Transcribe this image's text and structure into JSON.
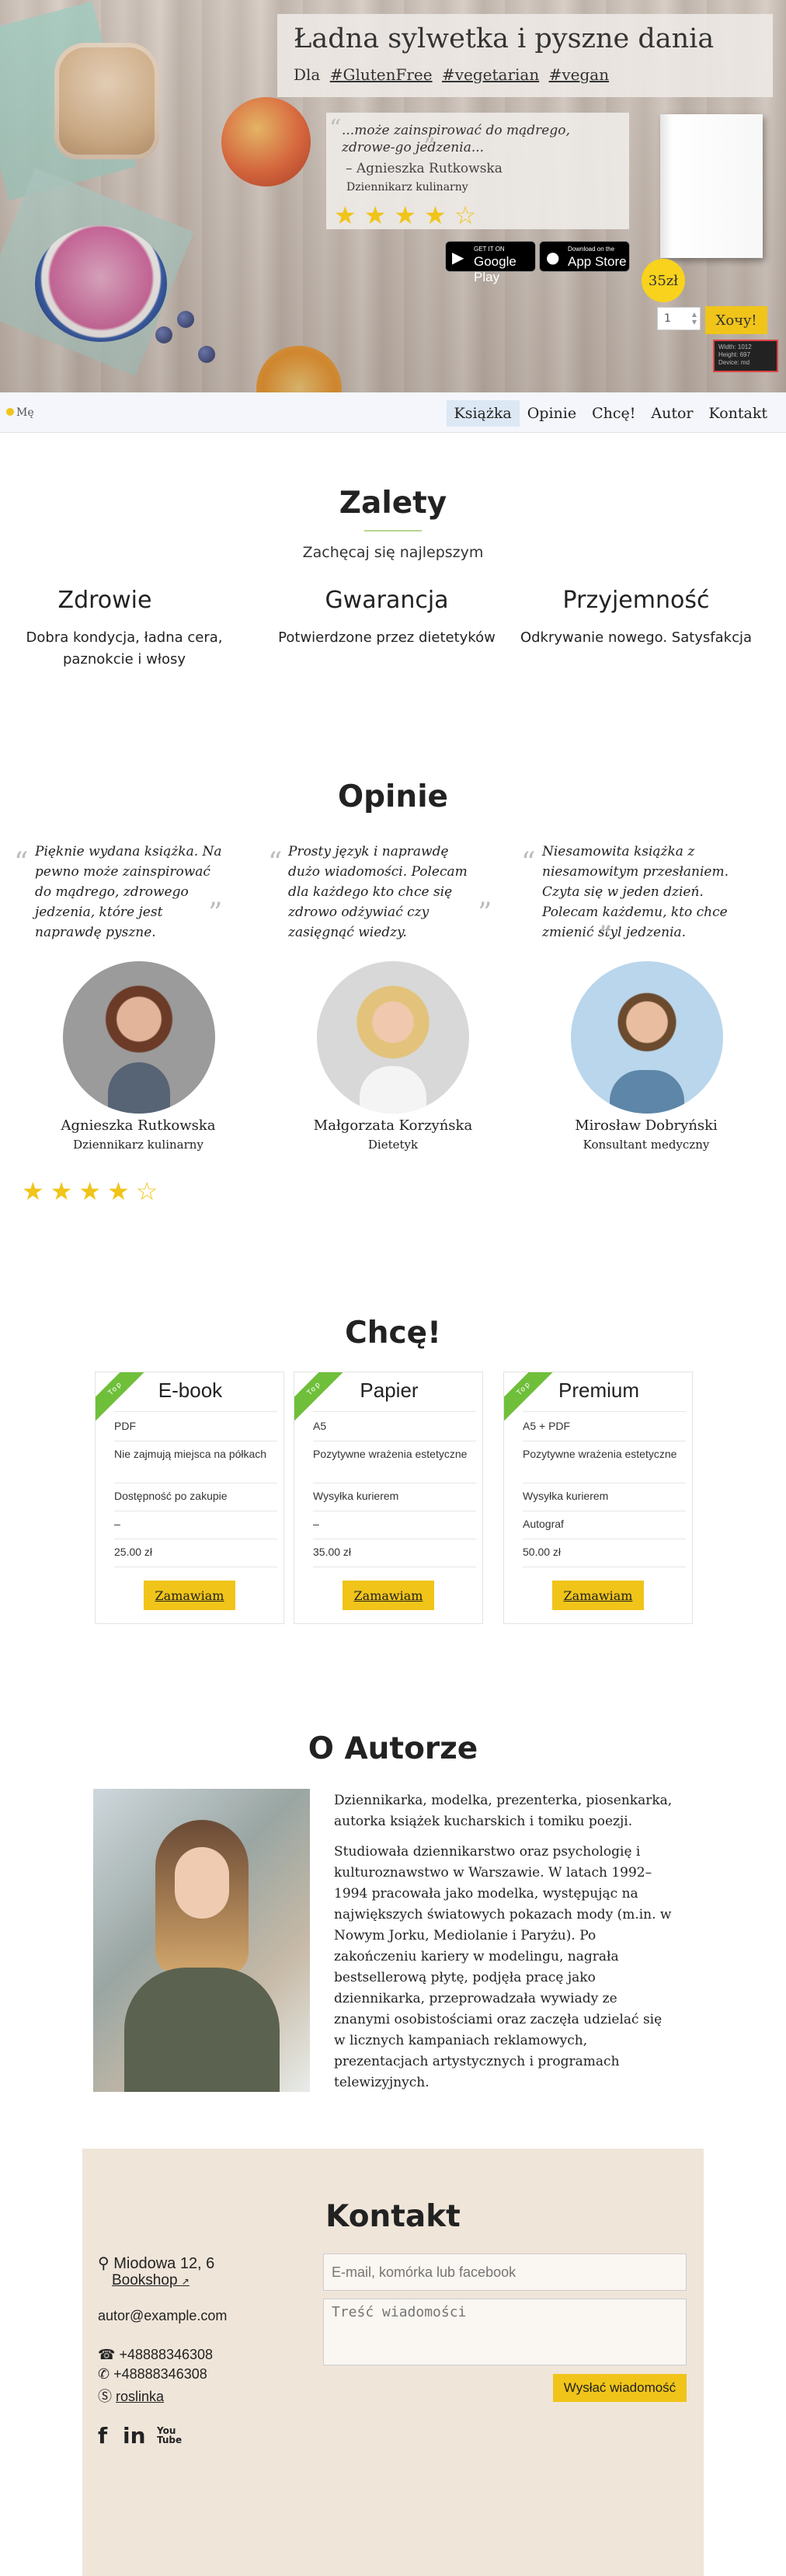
{
  "hero": {
    "title": "Ładna sylwetka i pyszne dania",
    "tags_prefix": "Dla",
    "tags": [
      "#GlutenFree",
      "#vegetarian",
      "#vegan"
    ],
    "quote": "...może zainspirować do mądrego, zdrowe-go jedzenia...",
    "quote_author": "– Agnieszka Rutkowska",
    "quote_role": "Dziennikarz kulinarny",
    "rating": 4,
    "rating_max": 5,
    "google_play_small": "GET IT ON",
    "google_play_big": "Google Play",
    "app_store_small": "Download on the",
    "app_store_big": "App Store",
    "price": "35zł",
    "quantity": "1",
    "buy_label": "Xoчy!",
    "device_info": [
      "Width: 1012",
      "Height: 697",
      "Device: md"
    ]
  },
  "nav": {
    "logo": "Mę",
    "items": [
      "Książka",
      "Opinie",
      "Chcę!",
      "Autor",
      "Kontakt"
    ],
    "active": "Książka"
  },
  "zalety": {
    "title": "Zalety",
    "subtitle": "Zachęcaj się najlepszym",
    "features": [
      {
        "title": "Zdrowie",
        "desc": "Dobra kondycja, ładna cera, paznokcie i włosy"
      },
      {
        "title": "Gwarancja",
        "desc": "Potwierdzone przez dietetyków"
      },
      {
        "title": "Przyjemność",
        "desc": "Odkrywanie nowego. Satysfakcja"
      }
    ]
  },
  "opinie": {
    "title": "Opinie",
    "items": [
      {
        "text": "Pięknie wydana książka. Na pewno może zainspirować do mądrego, zdrowego jedzenia, które jest naprawdę pyszne.",
        "name": "Agnieszka Rutkowska",
        "role": "Dziennikarz kulinarny"
      },
      {
        "text": "Prosty język i naprawdę dużo wiadomości. Polecam dla każdego kto chce się zdrowo odżywiać czy zasięgnąć wiedzy.",
        "name": "Małgorzata Korzyńska",
        "role": "Dietetyk"
      },
      {
        "text": "Niesamowita książka z niesamowitym przesłaniem. Czyta się w jeden dzień. Polecam każdemu, kto chce zmienić styl jedzenia.",
        "name": "Mirosław Dobryński",
        "role": "Konsultant medyczny"
      }
    ],
    "rating": 4,
    "rating_max": 5
  },
  "chce": {
    "title": "Chcę!",
    "ribbon": "Top",
    "button": "Zamawiam",
    "plans": [
      {
        "name": "E-book",
        "rows": [
          "PDF",
          "Nie zajmują miejsca na półkach",
          "Dostępność po zakupie",
          "–",
          "25.00 zł"
        ]
      },
      {
        "name": "Papier",
        "rows": [
          "A5",
          "Pozytywne wrażenia estetyczne",
          "Wysyłka kurierem",
          "–",
          "35.00 zł"
        ]
      },
      {
        "name": "Premium",
        "rows": [
          "A5 + PDF",
          "Pozytywne wrażenia estetyczne",
          "Wysyłka kurierem",
          "Autograf",
          "50.00 zł"
        ]
      }
    ]
  },
  "autor": {
    "title": "O Autorze",
    "p1": "Dziennikarka, modelka, prezenterka, piosenkarka, autorka książek kucharskich i tomiku poezji.",
    "p2": "Studiowała dziennikarstwo oraz psychologię i kulturoznawstwo w Warszawie. W latach 1992–1994 pracowała jako modelka, występując na największych światowych pokazach mody (m.in. w Nowym Jorku, Mediolanie i Paryżu). Po zakończeniu kariery w modelingu, nagrała bestsellerową płytę, podjęła pracę jako dziennikarka, przeprowadzała wywiady ze znanymi osobistościami oraz zaczęła udzielać się w licznych kampaniach reklamowych, prezentacjach artystycznych i programach telewizyjnych."
  },
  "kontakt": {
    "title": "Kontakt",
    "address": "Miodowa 12, 6",
    "shop": "Bookshop",
    "email": "autor@example.com",
    "phone": "+48888346308",
    "whatsapp": "+48888346308",
    "skype": "roslinka",
    "email_placeholder": "E-mail, komórka lub facebook",
    "message_placeholder": "Treść wiadomości",
    "send": "Wysłać wiadomość",
    "social": [
      "facebook-icon",
      "linkedin-icon",
      "youtube-icon"
    ],
    "youtube_label": "You\nTube"
  },
  "colors": {
    "accent": "#f0c419",
    "nav_bg": "#f4f6fb",
    "contact_bg": "#efe5d9",
    "ribbon": "#6fbf3a"
  }
}
